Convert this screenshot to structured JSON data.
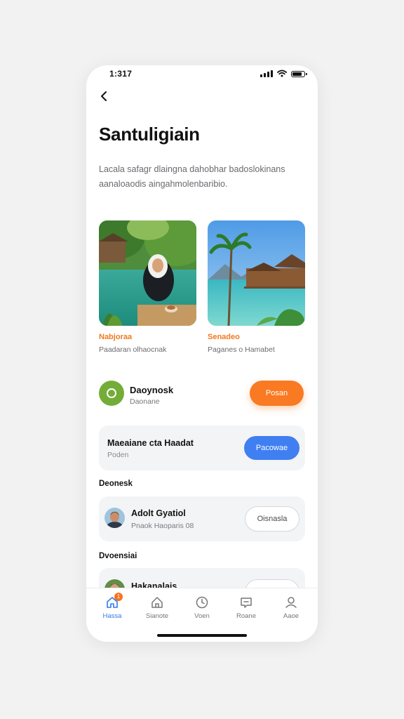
{
  "status_bar": {
    "time": "1:317"
  },
  "header": {
    "title": "Santuligiain"
  },
  "description": "Lacala safagr dlaingna dahobhar badoslokinans aanaloaodis aingahmolenbaribio.",
  "destinations": [
    {
      "name": "Nabjoraa",
      "subtitle": "Paadaran olhaocnak"
    },
    {
      "name": "Senadeo",
      "subtitle": "Paganes o Hamabet"
    }
  ],
  "featured": {
    "title": "Daoynosk",
    "subtitle": "Daonane",
    "button": "Posan"
  },
  "promo": {
    "title": "Maeaiane cta Haadat",
    "subtitle": "Poden",
    "button": "Pacowae"
  },
  "sections": {
    "first": "Deonesk",
    "second": "Dvoensiai"
  },
  "people": [
    {
      "name": "Adolt Gyatiol",
      "detail": "Pnaok Haoparis 08",
      "button": "Oisnasla"
    },
    {
      "name": "Hakanalais",
      "button": ""
    }
  ],
  "tabs": [
    {
      "label": "Hassa",
      "badge": "1"
    },
    {
      "label": "Sianote"
    },
    {
      "label": "Voen"
    },
    {
      "label": "Roane"
    },
    {
      "label": "Aaoe"
    }
  ],
  "colors": {
    "accent_orange": "#f97a22",
    "accent_blue": "#3f7ff2",
    "accent_green": "#73ad38",
    "active_tab": "#2f7be8"
  }
}
